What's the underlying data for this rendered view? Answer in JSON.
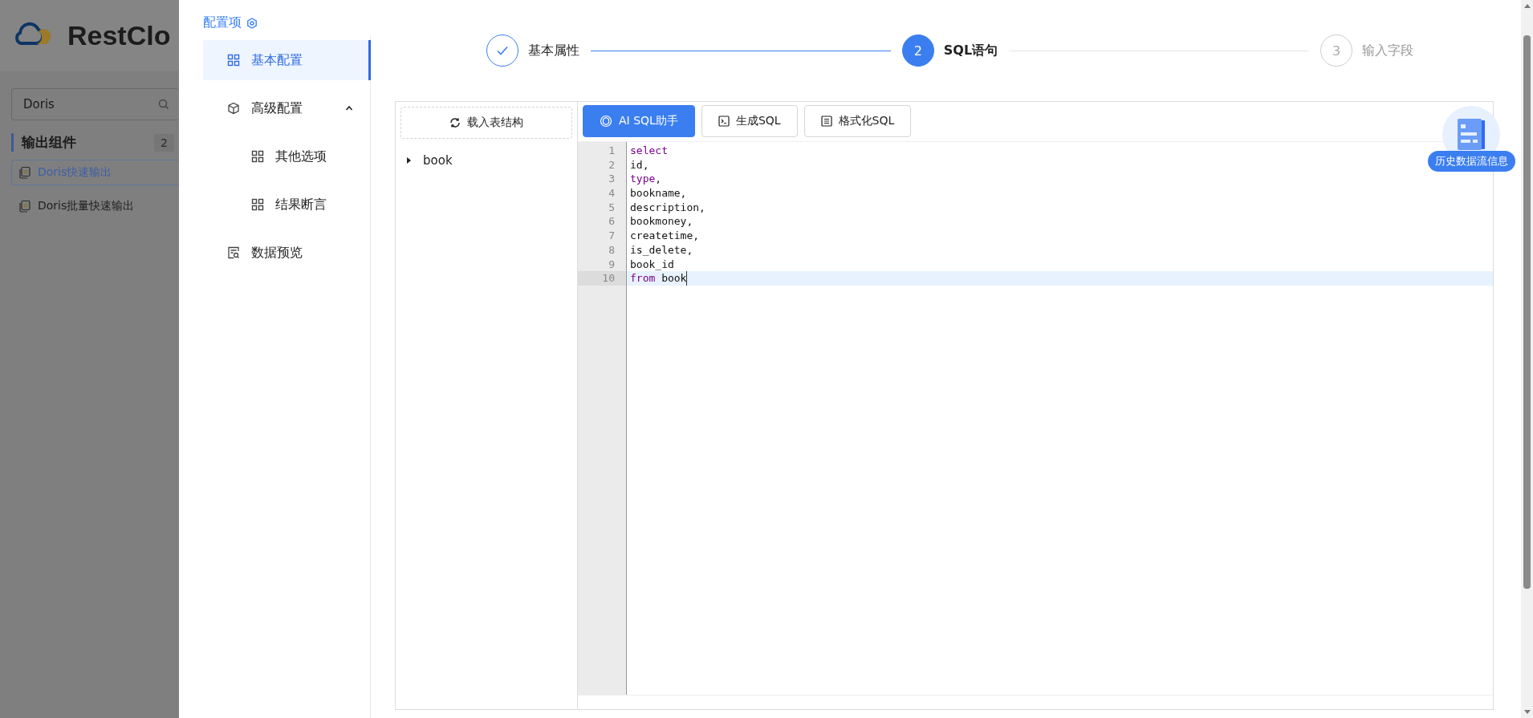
{
  "background_app": {
    "logo_text": "RestClo",
    "search": {
      "value": "Doris"
    },
    "section": {
      "title": "输出组件",
      "count": "2"
    },
    "items": [
      {
        "label": "Doris快速输出",
        "selected": true
      },
      {
        "label": "Doris批量快速输出",
        "selected": false
      }
    ]
  },
  "config_menu": {
    "title": "配置项",
    "items": [
      {
        "label": "基本配置",
        "selected": true
      },
      {
        "label": "高级配置",
        "selected": false,
        "expanded": true,
        "children": [
          {
            "label": "其他选项",
            "selected": false
          },
          {
            "label": "结果断言",
            "selected": false
          }
        ]
      },
      {
        "label": "数据预览",
        "selected": false
      }
    ]
  },
  "steps": [
    {
      "label": "基本属性",
      "completed": true,
      "selected": false
    },
    {
      "number": "2",
      "label": "SQL语句",
      "completed": false,
      "selected": true
    },
    {
      "number": "3",
      "label": "输入字段",
      "completed": false,
      "selected": false
    }
  ],
  "table_panel": {
    "load_button": "载入表结构",
    "tree": [
      {
        "label": "book",
        "expanded": false
      }
    ]
  },
  "toolbar": [
    {
      "label": "AI SQL助手",
      "kind": "primary"
    },
    {
      "label": "生成SQL",
      "kind": "default"
    },
    {
      "label": "格式化SQL",
      "kind": "default"
    }
  ],
  "editor": {
    "lines": [
      {
        "number": "1",
        "active": false,
        "tokens": [
          {
            "text": "select",
            "kind": "keyword"
          }
        ]
      },
      {
        "number": "2",
        "active": false,
        "tokens": [
          {
            "text": "id,",
            "kind": "plain"
          }
        ]
      },
      {
        "number": "3",
        "active": false,
        "tokens": [
          {
            "text": "type",
            "kind": "keyword"
          },
          {
            "text": ",",
            "kind": "plain"
          }
        ]
      },
      {
        "number": "4",
        "active": false,
        "tokens": [
          {
            "text": "bookname,",
            "kind": "plain"
          }
        ]
      },
      {
        "number": "5",
        "active": false,
        "tokens": [
          {
            "text": "description,",
            "kind": "plain"
          }
        ]
      },
      {
        "number": "6",
        "active": false,
        "tokens": [
          {
            "text": "bookmoney,",
            "kind": "plain"
          }
        ]
      },
      {
        "number": "7",
        "active": false,
        "tokens": [
          {
            "text": "createtime,",
            "kind": "plain"
          }
        ]
      },
      {
        "number": "8",
        "active": false,
        "tokens": [
          {
            "text": "is_delete,",
            "kind": "plain"
          }
        ]
      },
      {
        "number": "9",
        "active": false,
        "tokens": [
          {
            "text": "book_id",
            "kind": "plain"
          }
        ]
      },
      {
        "number": "10",
        "active": true,
        "tokens": [
          {
            "text": "from",
            "kind": "keyword"
          },
          {
            "text": " book",
            "kind": "plain"
          }
        ]
      }
    ]
  },
  "history_button": {
    "label": "历史数据流信息"
  }
}
